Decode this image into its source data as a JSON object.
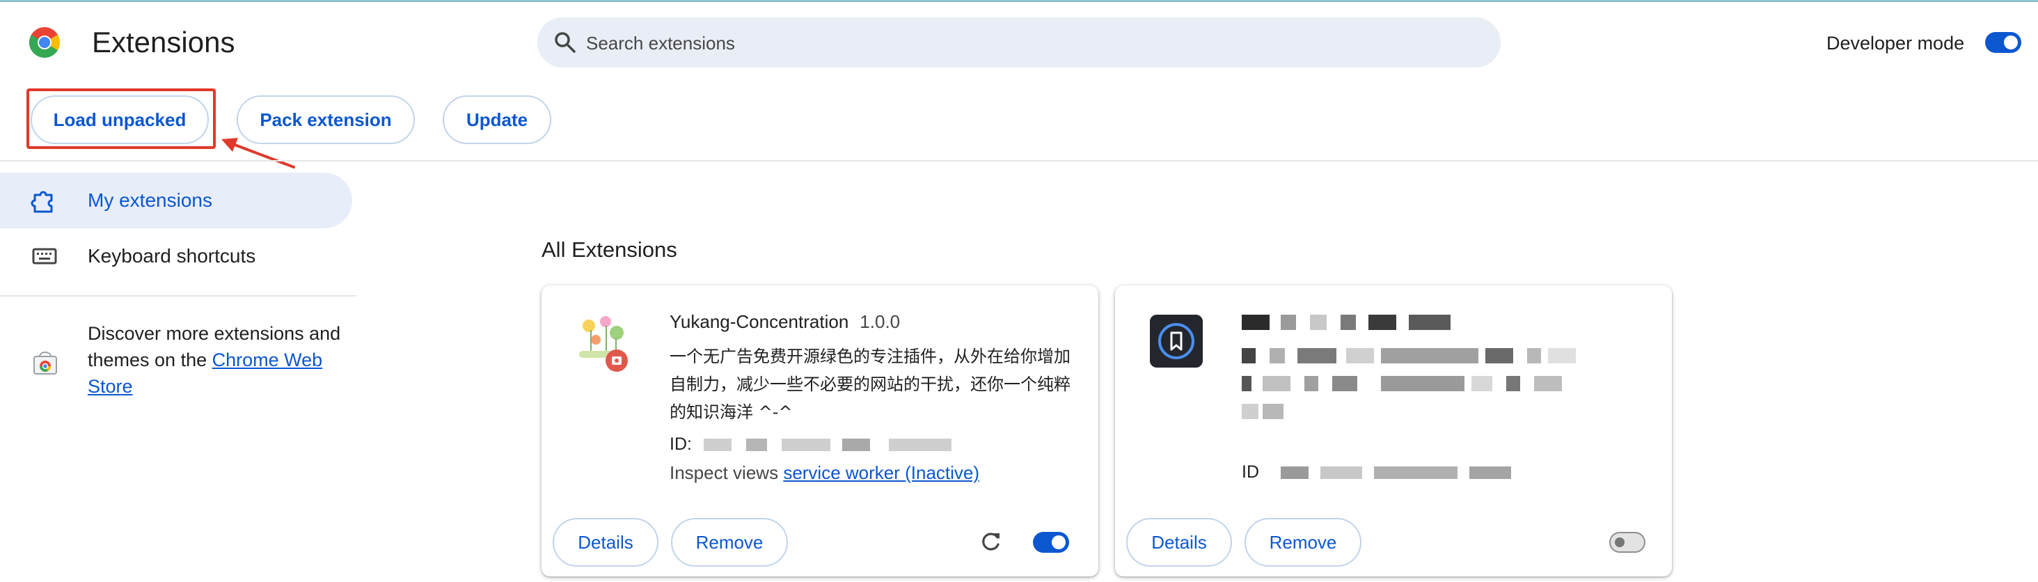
{
  "header": {
    "title": "Extensions",
    "search_placeholder": "Search extensions",
    "developer_mode_label": "Developer mode",
    "developer_mode_on": true
  },
  "actions": {
    "load_unpacked": "Load unpacked",
    "pack_extension": "Pack extension",
    "update": "Update"
  },
  "sidebar": {
    "items": [
      {
        "label": "My extensions",
        "active": true
      },
      {
        "label": "Keyboard shortcuts",
        "active": false
      }
    ],
    "discover_text": "Discover more extensions and themes on the ",
    "discover_link": "Chrome Web Store"
  },
  "main": {
    "section_title": "All Extensions",
    "extensions": [
      {
        "name": "Yukang-Concentration",
        "version": "1.0.0",
        "description": "一个无广告免费开源绿色的专注插件，从外在给你增加自制力，减少一些不必要的网站的干扰，还你一个纯粹的知识海洋 ^-^",
        "id_label": "ID:",
        "inspect_label": "Inspect views",
        "inspect_link": "service worker (Inactive)",
        "details_label": "Details",
        "remove_label": "Remove",
        "enabled": true
      },
      {
        "id_label": "ID",
        "details_label": "Details",
        "remove_label": "Remove",
        "enabled": false
      }
    ]
  },
  "colors": {
    "accent": "#0b57d0",
    "highlight": "#e0392b",
    "active_nav_bg": "#e8eef9",
    "search_bg": "#e9eef6"
  }
}
